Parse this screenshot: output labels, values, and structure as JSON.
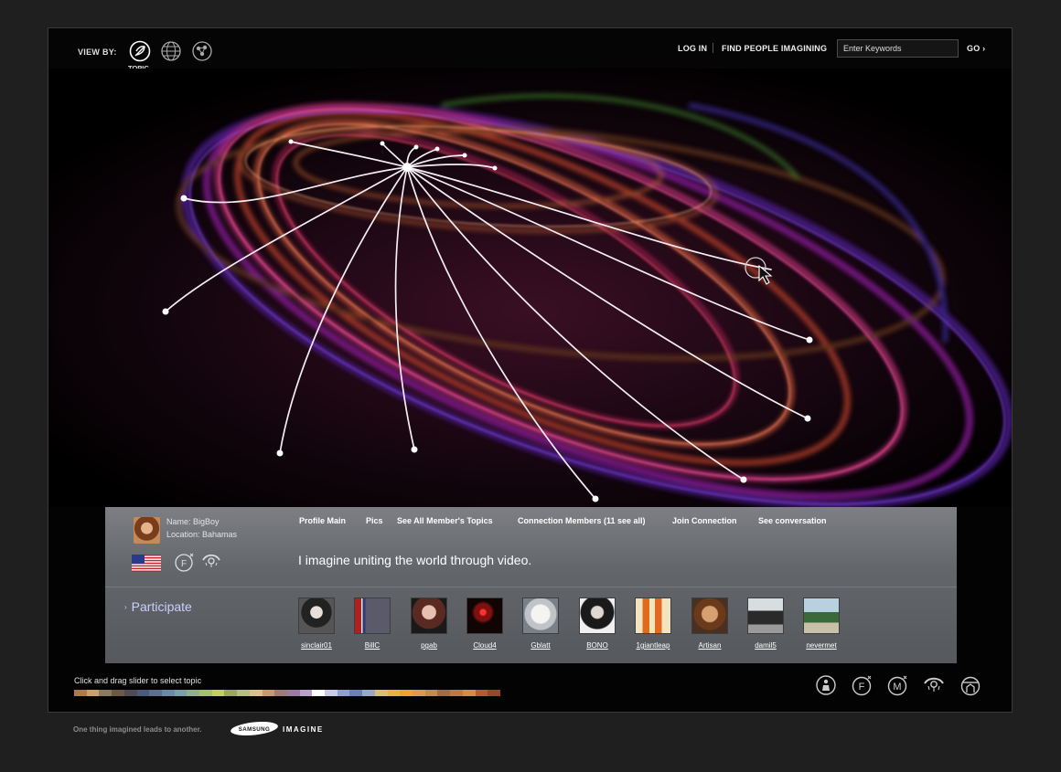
{
  "header": {
    "view_by_label": "VIEW BY:",
    "view_modes": [
      {
        "icon": "topic-icon",
        "caption": "TOPIC"
      },
      {
        "icon": "globe-icon"
      },
      {
        "icon": "people-network-icon"
      }
    ],
    "login_label": "LOG IN",
    "find_people_label": "FIND PEOPLE IMAGINING",
    "search_placeholder": "Enter Keywords",
    "go_label": "GO ›"
  },
  "profile": {
    "name_line": "Name: BigBoy",
    "location_line": "Location: Bahamas",
    "links": [
      "Profile Main",
      "Pics",
      "See All Member's Topics",
      "Connection Members (11 see all)",
      "Join Connection",
      "See conversation"
    ],
    "flag": "us-flag-icon",
    "statement": "I imagine uniting the world through video.",
    "participate_label": "Participate",
    "participate_arrow": "›"
  },
  "members": [
    {
      "name": "sinclair01"
    },
    {
      "name": "BillC"
    },
    {
      "name": "pgab"
    },
    {
      "name": "Cloud4"
    },
    {
      "name": "Gblatt"
    },
    {
      "name": "BONO"
    },
    {
      "name": "1giantleap"
    },
    {
      "name": "Artisan"
    },
    {
      "name": "damil5"
    },
    {
      "name": "nevermet"
    }
  ],
  "slider": {
    "label": "Click and drag slider to select topic",
    "colors": [
      "#b0793d",
      "#c8a06a",
      "#8a7b5e",
      "#6c5a44",
      "#4f4a56",
      "#4a5a7a",
      "#5c6f8f",
      "#6b8aa8",
      "#7aa0a8",
      "#8fb08a",
      "#a3bf6a",
      "#c2cf5a",
      "#9aa85a",
      "#b7c07a",
      "#d8c18a",
      "#c89870",
      "#a07a78",
      "#9a7aa0",
      "#b9a0c8",
      "#ffffff",
      "#c8cce8",
      "#8fa0d0",
      "#6a7fb8",
      "#9aa8c8",
      "#d8c070",
      "#e8b040",
      "#f0a030",
      "#e09850",
      "#c8884a",
      "#a86a3a",
      "#c07840",
      "#d88a44",
      "#b85a30",
      "#984828"
    ]
  },
  "bottom_icons": [
    "person-icon",
    "f-icon",
    "m-icon",
    "eye-icon",
    "dome-icon"
  ],
  "footer": {
    "tagline": "One thing imagined leads to another.",
    "brand": "SAMSUNG",
    "product": "IMAGINE"
  }
}
